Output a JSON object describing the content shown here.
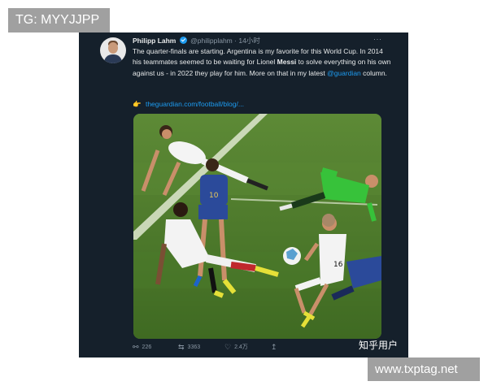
{
  "watermarks": {
    "top_left": "TG: MYYJJPP",
    "bottom_right": "www.txptag.net",
    "zhihu": "知乎用户"
  },
  "tweet": {
    "author_name": "Philipp Lahm",
    "handle": "@philipplahm",
    "separator": "·",
    "time": "14小时",
    "more": "···",
    "text_1": "The quarter-finals are starting. Argentina is my favorite for this World Cup. In 2014 his teammates seemed to be waiting for Lionel ",
    "text_bold": "Messi",
    "text_2": " to solve everything on his own against us - in 2022 they play for him. More on that in my latest ",
    "mention": "@guardian",
    "text_3": " column.",
    "link_emoji": "👉",
    "link_text": "theguardian.com/football/blog/...",
    "actions": {
      "reply_count": "226",
      "retweet_count": "3363",
      "like_count": "2.4万",
      "reply_icon": "reply-icon",
      "retweet_icon": "retweet-icon",
      "like_icon": "heart-icon",
      "share_icon": "share-icon"
    }
  },
  "colors": {
    "background": "#15202b",
    "accent": "#1d9bf0",
    "muted": "#8b98a5",
    "pitch": "#4f7a2e"
  }
}
